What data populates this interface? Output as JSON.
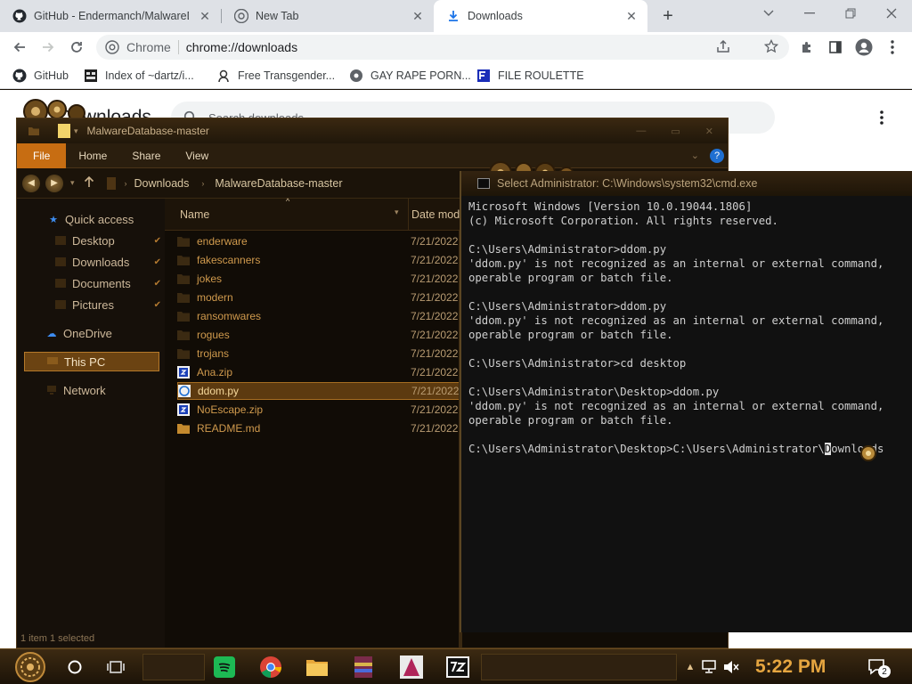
{
  "tabs": [
    {
      "title": "GitHub - Endermanch/MalwareDatabase",
      "icon": "github-icon",
      "close": "✕"
    },
    {
      "title": "New Tab",
      "icon": "chrome-icon",
      "close": "✕"
    },
    {
      "title": "Downloads",
      "icon": "download-icon",
      "close": "✕"
    }
  ],
  "new_tab": "+",
  "omnibox": {
    "chip": "Chrome",
    "url": "chrome://downloads"
  },
  "bookmarks": [
    {
      "label": "GitHub",
      "icon": "github-icon"
    },
    {
      "label": "Index of ~dartz/i...",
      "icon": "folder-icon"
    },
    {
      "label": "Free Transgender...",
      "icon": "site-icon"
    },
    {
      "label": "GAY RAPE PORN...",
      "icon": "globe-icon"
    },
    {
      "label": "FILE ROULETTE",
      "icon": "site-icon"
    }
  ],
  "downloads_page": {
    "title": "Downloads",
    "search_placeholder": "Search downloads"
  },
  "explorer": {
    "title": "MalwareDatabase-master",
    "ribbon": [
      "File",
      "Home",
      "Share",
      "View"
    ],
    "help": "?",
    "breadcrumb": [
      "Downloads",
      "MalwareDatabase-master"
    ],
    "nav": {
      "quick_access": "Quick access",
      "desktop": "Desktop",
      "downloads": "Downloads",
      "documents": "Documents",
      "pictures": "Pictures",
      "onedrive": "OneDrive",
      "this_pc": "This PC",
      "network": "Network"
    },
    "columns": {
      "name": "Name",
      "date": "Date modi"
    },
    "files": [
      {
        "name": "enderware",
        "date": "7/21/2022",
        "type": "folder"
      },
      {
        "name": "fakescanners",
        "date": "7/21/2022",
        "type": "folder"
      },
      {
        "name": "jokes",
        "date": "7/21/2022",
        "type": "folder"
      },
      {
        "name": "modern",
        "date": "7/21/2022",
        "type": "folder"
      },
      {
        "name": "ransomwares",
        "date": "7/21/2022",
        "type": "folder"
      },
      {
        "name": "rogues",
        "date": "7/21/2022",
        "type": "folder"
      },
      {
        "name": "trojans",
        "date": "7/21/2022",
        "type": "folder"
      },
      {
        "name": "Ana.zip",
        "date": "7/21/2022",
        "type": "zip"
      },
      {
        "name": "ddom.py",
        "date": "7/21/2022",
        "type": "py"
      },
      {
        "name": "NoEscape.zip",
        "date": "7/21/2022",
        "type": "zip"
      },
      {
        "name": "README.md",
        "date": "7/21/2022",
        "type": "md"
      }
    ],
    "status": "1 item 1 selected"
  },
  "cmd": {
    "title": "Select Administrator: C:\\Windows\\system32\\cmd.exe",
    "lines": [
      "Microsoft Windows [Version 10.0.19044.1806]",
      "(c) Microsoft Corporation. All rights reserved.",
      "",
      "C:\\Users\\Administrator>ddom.py",
      "'ddom.py' is not recognized as an internal or external command,",
      "operable program or batch file.",
      "",
      "C:\\Users\\Administrator>ddom.py",
      "'ddom.py' is not recognized as an internal or external command,",
      "operable program or batch file.",
      "",
      "C:\\Users\\Administrator>cd desktop",
      "",
      "C:\\Users\\Administrator\\Desktop>ddom.py",
      "'ddom.py' is not recognized as an internal or external command,",
      "operable program or batch file.",
      ""
    ],
    "prompt": "C:\\Users\\Administrator\\Desktop>C:\\Users\\Administrator\\",
    "cursor_char": "D",
    "after_cursor": "ownloads"
  },
  "taskbar": {
    "clock": "5:22 PM",
    "notifications": "2"
  }
}
